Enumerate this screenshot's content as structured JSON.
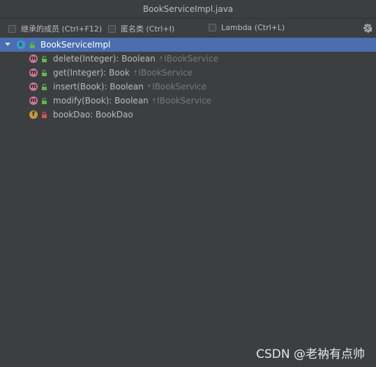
{
  "window": {
    "title": "BookServiceImpl.java"
  },
  "toolbar": {
    "options": [
      {
        "label": "继承的成员 (Ctrl+F12)",
        "checked": false
      },
      {
        "label": "匿名类 (Ctrl+I)",
        "checked": false
      },
      {
        "label": "Lambda (Ctrl+L)",
        "checked": false
      }
    ],
    "settings_icon": "gear-icon"
  },
  "tree": {
    "root": {
      "kind": "c",
      "label": "BookServiceImpl",
      "expanded": true,
      "selected": true
    },
    "members": [
      {
        "kind": "m",
        "visibility": "public",
        "label": "delete(Integer): Boolean",
        "inherited_from": "IBookService"
      },
      {
        "kind": "m",
        "visibility": "public",
        "label": "get(Integer): Book",
        "inherited_from": "IBookService"
      },
      {
        "kind": "m",
        "visibility": "public",
        "label": "insert(Book): Boolean",
        "inherited_from": "IBookService"
      },
      {
        "kind": "m",
        "visibility": "public",
        "label": "modify(Book): Boolean",
        "inherited_from": "IBookService"
      },
      {
        "kind": "f",
        "visibility": "private",
        "label": "bookDao: BookDao",
        "inherited_from": ""
      }
    ]
  },
  "watermark": "CSDN @老衲有点帅",
  "colors": {
    "background": "#3c3f41",
    "selection": "#4b6eaf",
    "text": "#bbbbbb",
    "muted": "#787878",
    "class_icon": "#3d9ad1",
    "method_icon": "#c87a94",
    "field_icon": "#c79a3c",
    "public_lock": "#5fb84e",
    "private_lock": "#d9534f"
  }
}
